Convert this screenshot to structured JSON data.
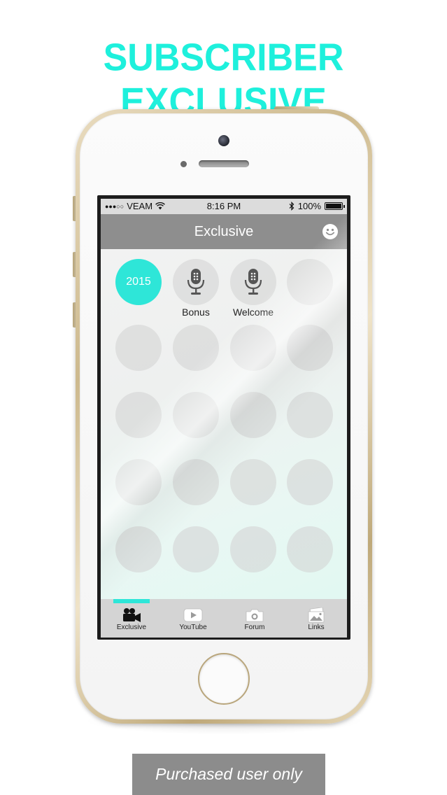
{
  "promo": {
    "headline": "SUBSCRIBER EXCLUSIVE",
    "footer_badge": "Purchased user only"
  },
  "status_bar": {
    "carrier": "VEAM",
    "signal_dots": "●●●○○",
    "time": "8:16 PM",
    "battery": "100%",
    "battery_level": 1.0
  },
  "nav": {
    "title": "Exclusive",
    "right_icon": "smiley-icon"
  },
  "grid": {
    "items": [
      {
        "text": "2015",
        "label": "",
        "icon": "",
        "highlighted": true
      },
      {
        "text": "",
        "label": "Bonus",
        "icon": "microphone-icon",
        "highlighted": false
      },
      {
        "text": "",
        "label": "Welcome",
        "icon": "microphone-icon",
        "highlighted": false
      }
    ]
  },
  "tabbar": {
    "tabs": [
      {
        "label": "Exclusive",
        "icon": "video-camera-icon",
        "selected": true
      },
      {
        "label": "YouTube",
        "icon": "youtube-play-icon",
        "selected": false
      },
      {
        "label": "Forum",
        "icon": "camera-icon",
        "selected": false
      },
      {
        "label": "Links",
        "icon": "photos-icon",
        "selected": false
      }
    ]
  },
  "colors": {
    "accent": "#2ee6d8",
    "headline": "#1ef0dc",
    "navbar": "#8e8e8e",
    "tabbar": "#d4d4d4",
    "badge": "#8c8c8c"
  }
}
